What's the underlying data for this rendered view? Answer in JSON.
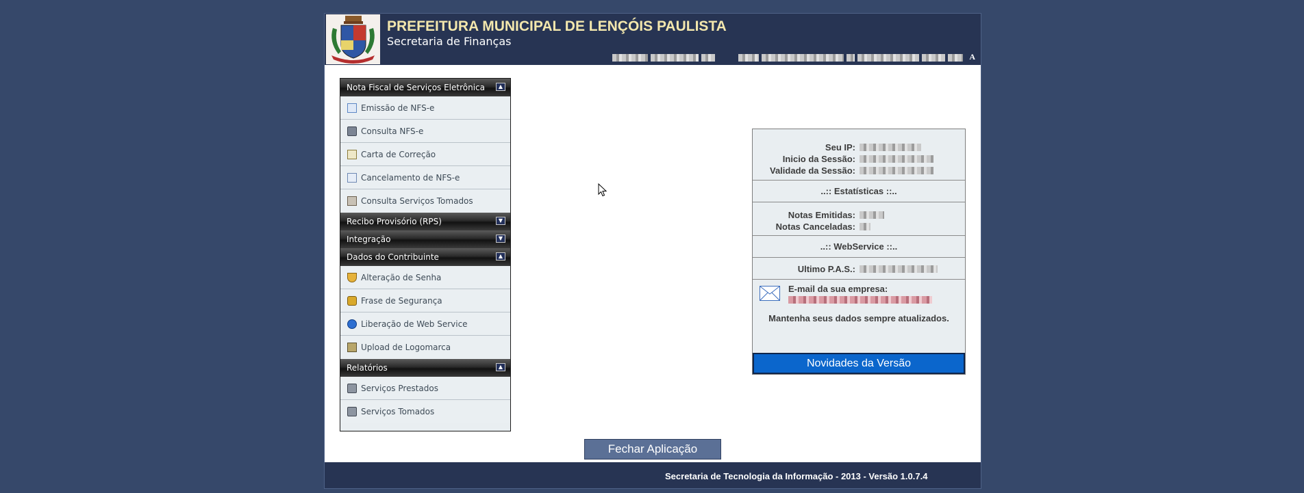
{
  "header": {
    "title": "PREFEITURA MUNICIPAL DE LENÇÓIS PAULISTA",
    "subtitle": "Secretaria de Finanças",
    "end_char": "A"
  },
  "menu": {
    "nfse": {
      "title": "Nota Fiscal de Serviços Eletrônica",
      "items": [
        "Emissão de NFS-e",
        "Consulta NFS-e",
        "Carta de Correção",
        "Cancelamento de NFS-e",
        "Consulta Serviços Tomados"
      ]
    },
    "rps": {
      "title": "Recibo Provisório (RPS)"
    },
    "integracao": {
      "title": "Integração"
    },
    "contribuinte": {
      "title": "Dados do Contribuinte",
      "items": [
        "Alteração de Senha",
        "Frase de Segurança",
        "Liberação de Web Service",
        "Upload de Logomarca"
      ]
    },
    "relatorios": {
      "title": "Relatórios",
      "items": [
        "Serviços Prestados",
        "Serviços Tomados"
      ]
    }
  },
  "info": {
    "ip_label": "Seu IP:",
    "inicio_label": "Inicio da Sessão:",
    "validade_label": "Validade da Sessão:",
    "estatisticas": "..:: Estatísticas ::..",
    "emitidas_label": "Notas Emitidas:",
    "canceladas_label": "Notas Canceladas:",
    "webservice": "..:: WebService ::..",
    "pas_label": "Ultimo P.A.S.:",
    "email_label": "E-mail da sua empresa:",
    "mantenha": "Mantenha seus dados sempre atualizados.",
    "novidades": "Novidades da Versão"
  },
  "close_button": "Fechar Aplicação",
  "footer": "Secretaria de Tecnologia da Informação - 2013 - Versão 1.0.7.4"
}
